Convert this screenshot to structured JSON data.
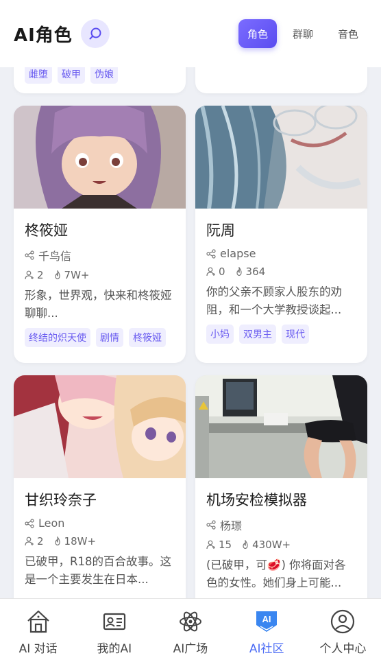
{
  "header": {
    "title": "AI角色",
    "tabs": [
      {
        "label": "角色"
      },
      {
        "label": "群聊"
      },
      {
        "label": "音色"
      }
    ]
  },
  "partial_top": {
    "left_tags": [
      "雌堕",
      "破甲",
      "伪娘"
    ]
  },
  "cards": [
    {
      "name": "柊筱娅",
      "author": "千鸟信",
      "users": "2",
      "heat": "7W+",
      "desc": "形象，世界观，快来和柊筱娅聊聊...",
      "tags": [
        "终结的炽天使",
        "剧情",
        "柊筱娅"
      ]
    },
    {
      "name": "阮周",
      "author": "elapse",
      "users": "0",
      "heat": "364",
      "desc": "你的父亲不顾家人股东的劝阻，和一个大学教授谈起...",
      "tags": [
        "小妈",
        "双男主",
        "现代"
      ]
    },
    {
      "name": "甘织玲奈子",
      "author": "Leon",
      "users": "2",
      "heat": "18W+",
      "desc": "已破甲，R18的百合故事。这是一个主要发生在日本...",
      "tags": []
    },
    {
      "name": "机场安检模拟器",
      "author": "杨璟",
      "users": "15",
      "heat": "430W+",
      "desc": "(已破甲，可🥩) 你将面对各色的女性。她们身上可能...",
      "tags": []
    }
  ],
  "nav": [
    {
      "label": "AI 对话"
    },
    {
      "label": "我的AI"
    },
    {
      "label": "AI广场"
    },
    {
      "label": "AI社区"
    },
    {
      "label": "个人中心"
    }
  ],
  "colors": {
    "accent": "#5a4cf0",
    "nav_active": "#4c6cf5"
  }
}
